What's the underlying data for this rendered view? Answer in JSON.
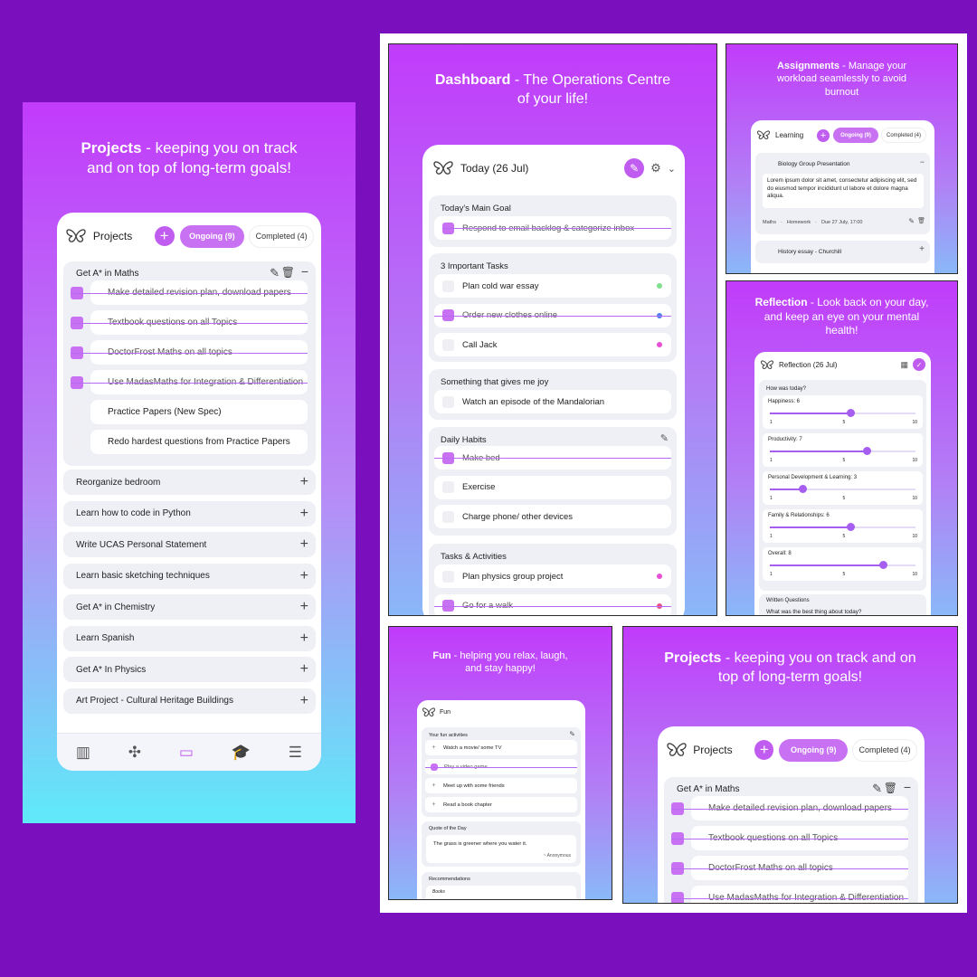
{
  "left": {
    "headline_bold": "Projects",
    "headline_rest": " - keeping you on track and on top of long-term goals!",
    "title": "Projects",
    "ongoing": "Ongoing (9)",
    "completed": "Completed (4)",
    "group_title": "Get A* in Maths",
    "tasks": [
      {
        "text": "Make detailed revision plan, download papers",
        "done": true
      },
      {
        "text": "Textbook questions on all Topics",
        "done": true
      },
      {
        "text": "DoctorFrost Maths on all topics",
        "done": true
      },
      {
        "text": "Use MadasMaths for Integration & Differentiation",
        "done": true
      },
      {
        "text": "Practice Papers (New Spec)",
        "done": false
      },
      {
        "text": "Redo hardest questions from Practice Papers",
        "done": false
      }
    ],
    "projects": [
      "Reorganize bedroom",
      "Learn how to code in Python",
      "Write UCAS Personal Statement",
      "Learn basic sketching techniques",
      "Get A* in Chemistry",
      "Learn Spanish",
      "Get A* In Physics",
      "Art Project - Cultural Heritage Buildings"
    ]
  },
  "dashboard": {
    "headline_bold": "Dashboard",
    "headline_rest": " - The Operations Centre of your life!",
    "title": "Today (26 Jul)",
    "main_goal_title": "Today's Main Goal",
    "main_goal": "Respond to email backlog & categorize inbox",
    "important_title": "3 Important Tasks",
    "important": [
      {
        "text": "Plan cold war essay",
        "done": false,
        "color": "#7ee08a"
      },
      {
        "text": "Order new clothes online",
        "done": true,
        "color": "#4f7ff2"
      },
      {
        "text": "Call Jack",
        "done": false,
        "color": "#e94fd4"
      }
    ],
    "joy_title": "Something that gives me joy",
    "joy": "Watch an episode of the Mandalorian",
    "habits_title": "Daily Habits",
    "habits": [
      {
        "text": "Make bed",
        "done": true
      },
      {
        "text": "Exercise",
        "done": false
      },
      {
        "text": "Charge phone/ other devices",
        "done": false
      }
    ],
    "tasks_title": "Tasks & Activities",
    "tasks": [
      {
        "text": "Plan physics group project",
        "done": false,
        "color": "#e94fd4"
      },
      {
        "text": "Go for a walk",
        "done": true,
        "color": "#e94f8a"
      }
    ]
  },
  "assignments": {
    "headline_bold": "Assignments",
    "headline_rest": " - Manage your workload seamlessly to avoid burnout",
    "title": "Learning",
    "ongoing": "Ongoing (9)",
    "completed": "Completed (4)",
    "item1": "Biology Group Presentation",
    "item1_desc": "Lorem ipsum dolor sit amet, consectetur adipiscing elit, sed do eiusmod tempor incididunt ut labore et dolore magna aliqua.",
    "item1_subject": "Maths",
    "item1_type": "Homework",
    "item1_due": "Due 27 July, 17:00",
    "item2": "History essay - Churchill"
  },
  "reflection": {
    "headline_bold": "Reflection",
    "headline_rest": " - Look back on your day, and keep an eye on your mental health!",
    "title": "Reflection (26 Jul)",
    "question": "How was today?",
    "sliders": [
      {
        "label": "Happiness: 6",
        "value": 6
      },
      {
        "label": "Productivity: 7",
        "value": 7
      },
      {
        "label": "Personal Development & Learning: 3",
        "value": 3
      },
      {
        "label": "Family & Relationships: 6",
        "value": 6
      },
      {
        "label": "Overall: 8",
        "value": 8
      }
    ],
    "min": "1",
    "mid": "5",
    "max": "10",
    "written_title": "Written Questions",
    "written_q": "What was the best thing about today?"
  },
  "fun": {
    "headline_bold": "Fun",
    "headline_rest": " - helping you relax, laugh, and stay happy!",
    "title": "Fun",
    "activities_title": "Your fun activities",
    "activities": [
      {
        "text": "Watch a movie/ some TV",
        "done": false
      },
      {
        "text": "Play a video game",
        "done": true
      },
      {
        "text": "Meet up with some friends",
        "done": false
      },
      {
        "text": "Read a book chapter",
        "done": false
      }
    ],
    "quote_title": "Quote of the Day",
    "quote": "The grass is greener where you water it.",
    "quote_author": "~ Anonymous",
    "rec_title": "Recommendations",
    "rec_sub": "Books"
  },
  "projects2": {
    "headline_bold": "Projects",
    "headline_rest": " - keeping you on track and on top of long-term goals!",
    "title": "Projects",
    "ongoing": "Ongoing (9)",
    "completed": "Completed (4)",
    "group_title": "Get A* in Maths",
    "tasks": [
      "Make detailed revision plan, download papers",
      "Textbook questions on all Topics",
      "DoctorFrost Maths on all topics",
      "Use MadasMaths for Integration & Differentiation"
    ]
  }
}
